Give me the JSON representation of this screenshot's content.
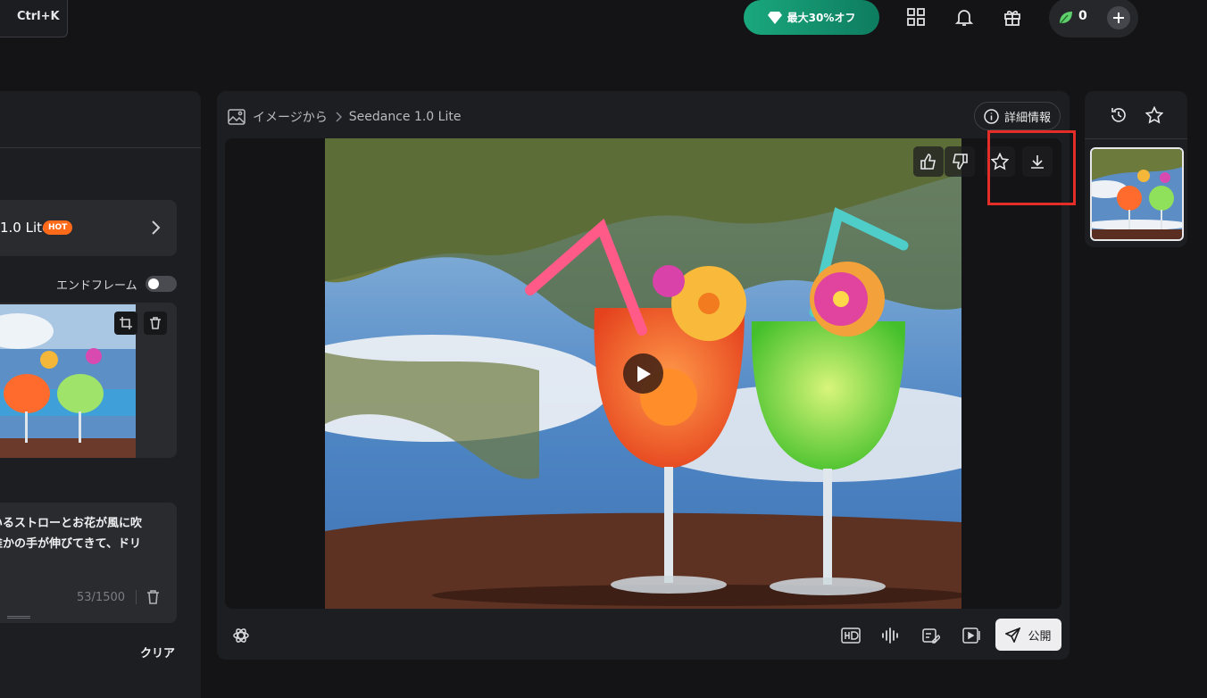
{
  "topbar": {
    "shortcut_label": "Ctrl+K",
    "promo_label": "最大30%オフ",
    "credits_count": "0",
    "icons": [
      "apps-grid-icon",
      "bell-icon",
      "gift-icon",
      "leaf-icon",
      "plus-icon"
    ]
  },
  "left": {
    "model_name": "1.0 Lite",
    "model_badge": "HOT",
    "end_frame_label": "エンドフレーム",
    "end_frame_on": false,
    "prompt_line1": "いるストローとお花が風に吹",
    "prompt_line2": "誰かの手が伸びてきて、ドリ",
    "prompt_counter": "53/1500",
    "clear_label": "クリア"
  },
  "center": {
    "breadcrumb_source": "イメージから",
    "breadcrumb_model": "Seedance 1.0 Lite",
    "details_label": "詳細情報",
    "publish_label": "公開"
  },
  "colors": {
    "background": "#141416",
    "panel": "#1d1e21",
    "promo_green": "#10926d",
    "hot_orange": "#ff6a1a",
    "highlight_red": "#e52d27"
  }
}
